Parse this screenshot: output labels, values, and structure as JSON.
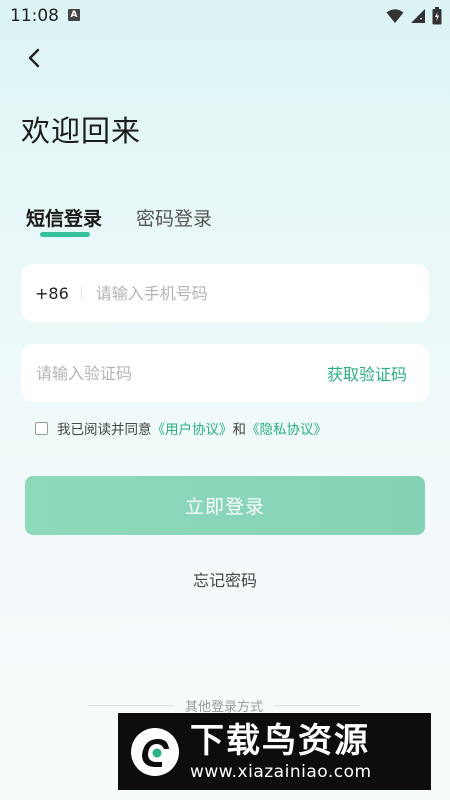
{
  "status_bar": {
    "time": "11:08",
    "notification_letter": "A",
    "icons": [
      "wifi-icon",
      "signal-icon",
      "battery-icon"
    ]
  },
  "header": {
    "back_icon": "chevron-left-icon",
    "title": "欢迎回来"
  },
  "tabs": [
    {
      "label": "短信登录",
      "active": true
    },
    {
      "label": "密码登录",
      "active": false
    }
  ],
  "phone_field": {
    "country_code": "+86",
    "value": "",
    "placeholder": "请输入手机号码"
  },
  "code_field": {
    "value": "",
    "placeholder": "请输入验证码",
    "get_code_label": "获取验证码"
  },
  "agreement": {
    "checked": false,
    "prefix": "我已阅读并同意",
    "user_agreement": "《用户协议》",
    "conjunction": "和",
    "privacy_policy": "《隐私协议》"
  },
  "login_button": {
    "label": "立即登录"
  },
  "forgot_password": "忘记密码",
  "other_login": {
    "label": "其他登录方式"
  },
  "watermark": {
    "title": "下载鸟资源",
    "url": "www.xiazainiao.com"
  },
  "colors": {
    "accent": "#2bb07f",
    "tab_underline": "#36c29a",
    "login_button": "#8cd7b9",
    "background_top": "#dcf4f4",
    "background_bottom": "#f7fbfc"
  }
}
